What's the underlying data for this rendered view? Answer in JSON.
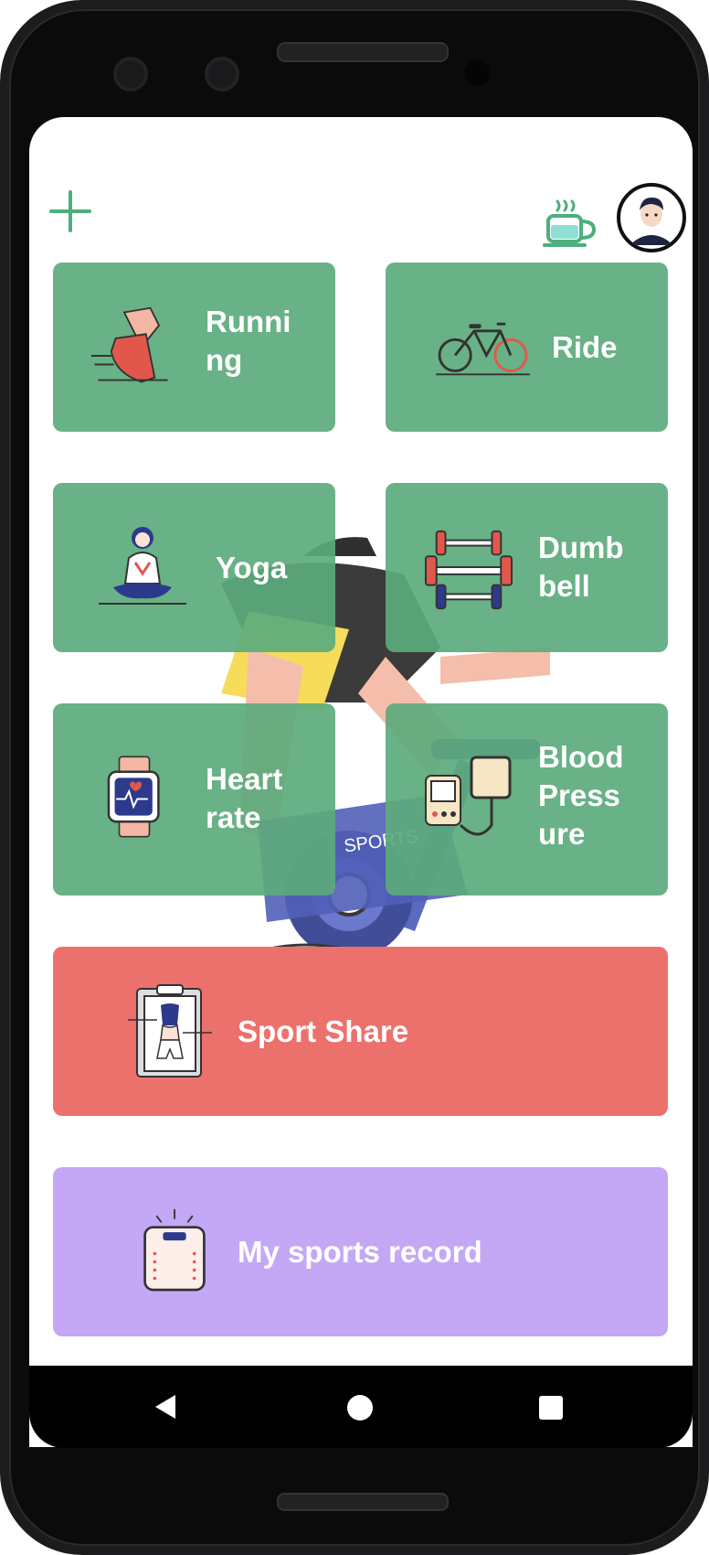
{
  "toolbar": {
    "add_icon": "plus-icon",
    "drink_icon": "cup-icon",
    "avatar_icon": "user-avatar"
  },
  "cards": [
    {
      "id": "running",
      "label": "Runni\nng",
      "icon": "running-shoe-icon"
    },
    {
      "id": "ride",
      "label": "Ride",
      "icon": "bicycle-icon"
    },
    {
      "id": "yoga",
      "label": "Yoga",
      "icon": "yoga-icon"
    },
    {
      "id": "dumbbell",
      "label": "Dumb\nbell",
      "icon": "dumbbell-icon"
    },
    {
      "id": "heart-rate",
      "label": "Heart\nrate",
      "icon": "smartwatch-icon"
    },
    {
      "id": "blood-pressure",
      "label": "Blood\nPress\nure",
      "icon": "blood-pressure-monitor-icon"
    },
    {
      "id": "sport-share",
      "label": "Sport Share",
      "icon": "body-measure-icon"
    },
    {
      "id": "sports-record",
      "label": "My sports record",
      "icon": "scale-icon"
    }
  ],
  "background_art": {
    "text": "SPORTS"
  },
  "colors": {
    "green": "#5caa7c",
    "red": "#ec716c",
    "purple": "#c4a8f5"
  },
  "navbar": {
    "back": "back-triangle-icon",
    "home": "home-circle-icon",
    "recents": "recents-square-icon"
  }
}
